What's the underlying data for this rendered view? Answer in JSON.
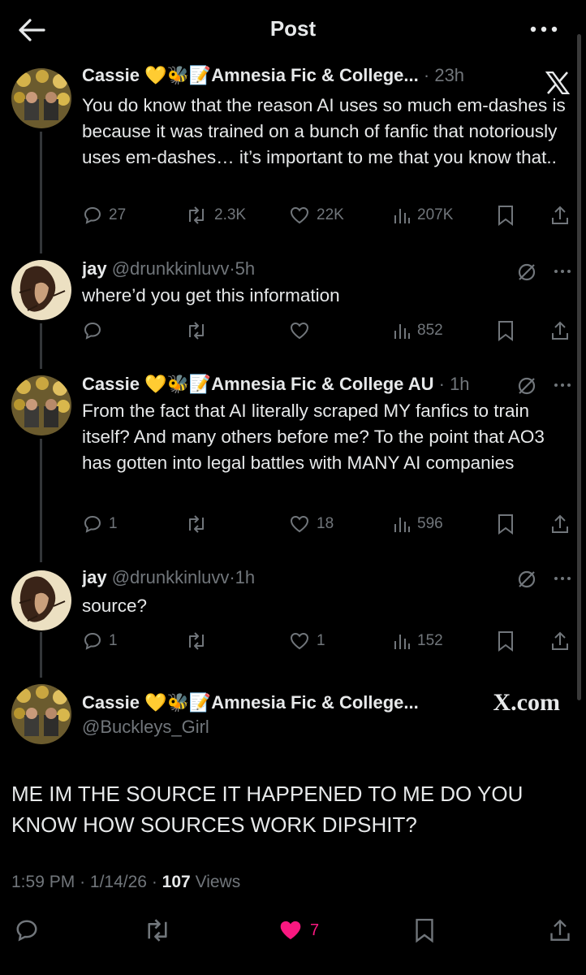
{
  "header": {
    "title": "Post"
  },
  "tweets": [
    {
      "display_name": "Cassie 💛🐝📝Amnesia Fic & College...",
      "handle": "",
      "sep": "·",
      "time": "23h",
      "text": "You do know that the reason AI uses so much em-dashes is because it was trained on a bunch of fanfic that notoriously uses em-dashes… it’s important to me that you know that..",
      "replies": "27",
      "reposts": "2.3K",
      "likes": "22K",
      "views": "207K"
    },
    {
      "display_name": "jay",
      "handle": "@drunkkinluvv",
      "sep": "·",
      "time": "5h",
      "text": "where’d you get this information",
      "replies": "",
      "reposts": "",
      "likes": "",
      "views": "852"
    },
    {
      "display_name": "Cassie 💛🐝📝Amnesia Fic & College AU",
      "handle": "",
      "sep": "·",
      "time": "1h",
      "text": "From the fact that AI literally scraped MY fanfics to train itself? And many others before me? To the point that AO3 has gotten into legal battles with MANY AI companies",
      "replies": "1",
      "reposts": "",
      "likes": "18",
      "views": "596"
    },
    {
      "display_name": "jay",
      "handle": "@drunkkinluvv",
      "sep": "·",
      "time": "1h",
      "text": "source?",
      "replies": "1",
      "reposts": "",
      "likes": "1",
      "views": "152"
    }
  ],
  "main_post": {
    "display_name": "Cassie 💛🐝📝Amnesia Fic & College...",
    "handle": "@Buckleys_Girl",
    "text": "ME IM THE SOURCE IT HAPPENED TO ME DO YOU KNOW HOW SOURCES WORK DIPSHIT?",
    "time": "1:59 PM",
    "date": "1/14/26",
    "sep": "·",
    "views_count": "107",
    "views_label": "Views",
    "likes": "7"
  },
  "watermark": "X.com",
  "colors": {
    "background": "#000000",
    "text": "#e7e9ea",
    "dim": "#71767b",
    "like_active": "#f91880",
    "thread_line": "#333639"
  }
}
